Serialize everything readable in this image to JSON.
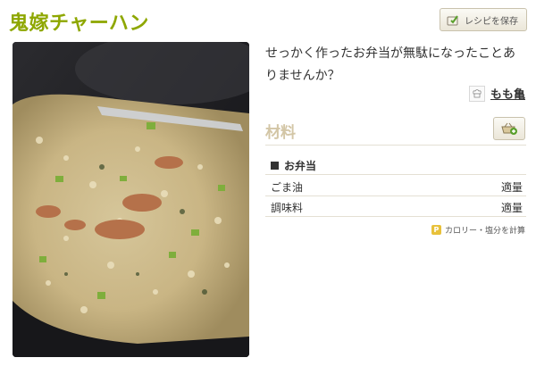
{
  "recipe": {
    "title": "鬼嫁チャーハン",
    "save_label": "レシピを保存",
    "description": "せっかく作ったお弁当が無駄になったことありませんか？",
    "author": "もも亀",
    "photo_icon": "fried-rice-photo"
  },
  "ingredients": {
    "heading": "材料",
    "group": "お弁当",
    "items": [
      {
        "name": "ごま油",
        "amount": "適量"
      },
      {
        "name": "調味料",
        "amount": "適量"
      }
    ],
    "calorie_link": "カロリー・塩分を計算"
  },
  "colors": {
    "title": "#8ea700",
    "heading": "#d3c6a6",
    "accent_green": "#5aa02c"
  }
}
